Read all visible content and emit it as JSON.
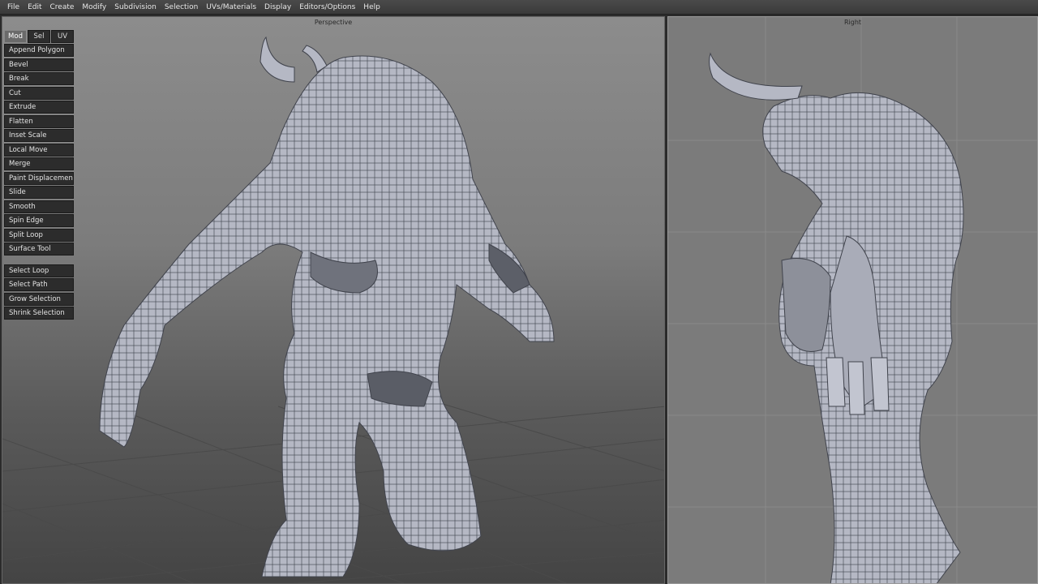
{
  "menu": [
    "File",
    "Edit",
    "Create",
    "Modify",
    "Subdivision",
    "Selection",
    "UVs/Materials",
    "Display",
    "Editors/Options",
    "Help"
  ],
  "viewports": {
    "perspective_label": "Perspective",
    "right_label": "Right"
  },
  "palette": {
    "tabs": [
      "Mod",
      "Sel",
      "UV"
    ],
    "active_tab": "Mod",
    "modify_tools": [
      "Append Polygon",
      "Bevel",
      "Break",
      "Cut",
      "Extrude",
      "Flatten",
      "Inset Scale",
      "Local Move",
      "Merge",
      "Paint Displacement",
      "Slide",
      "Smooth",
      "Spin Edge",
      "Split Loop",
      "Surface Tool"
    ],
    "selection_tools": [
      "Select Loop",
      "Select Path",
      "Grow Selection",
      "Shrink Selection"
    ]
  },
  "colors": {
    "menubar": "#3f3f3f",
    "button": "#2c2c2c",
    "active_tab": "#6a6a6a",
    "mesh": "#b9bcc8"
  }
}
